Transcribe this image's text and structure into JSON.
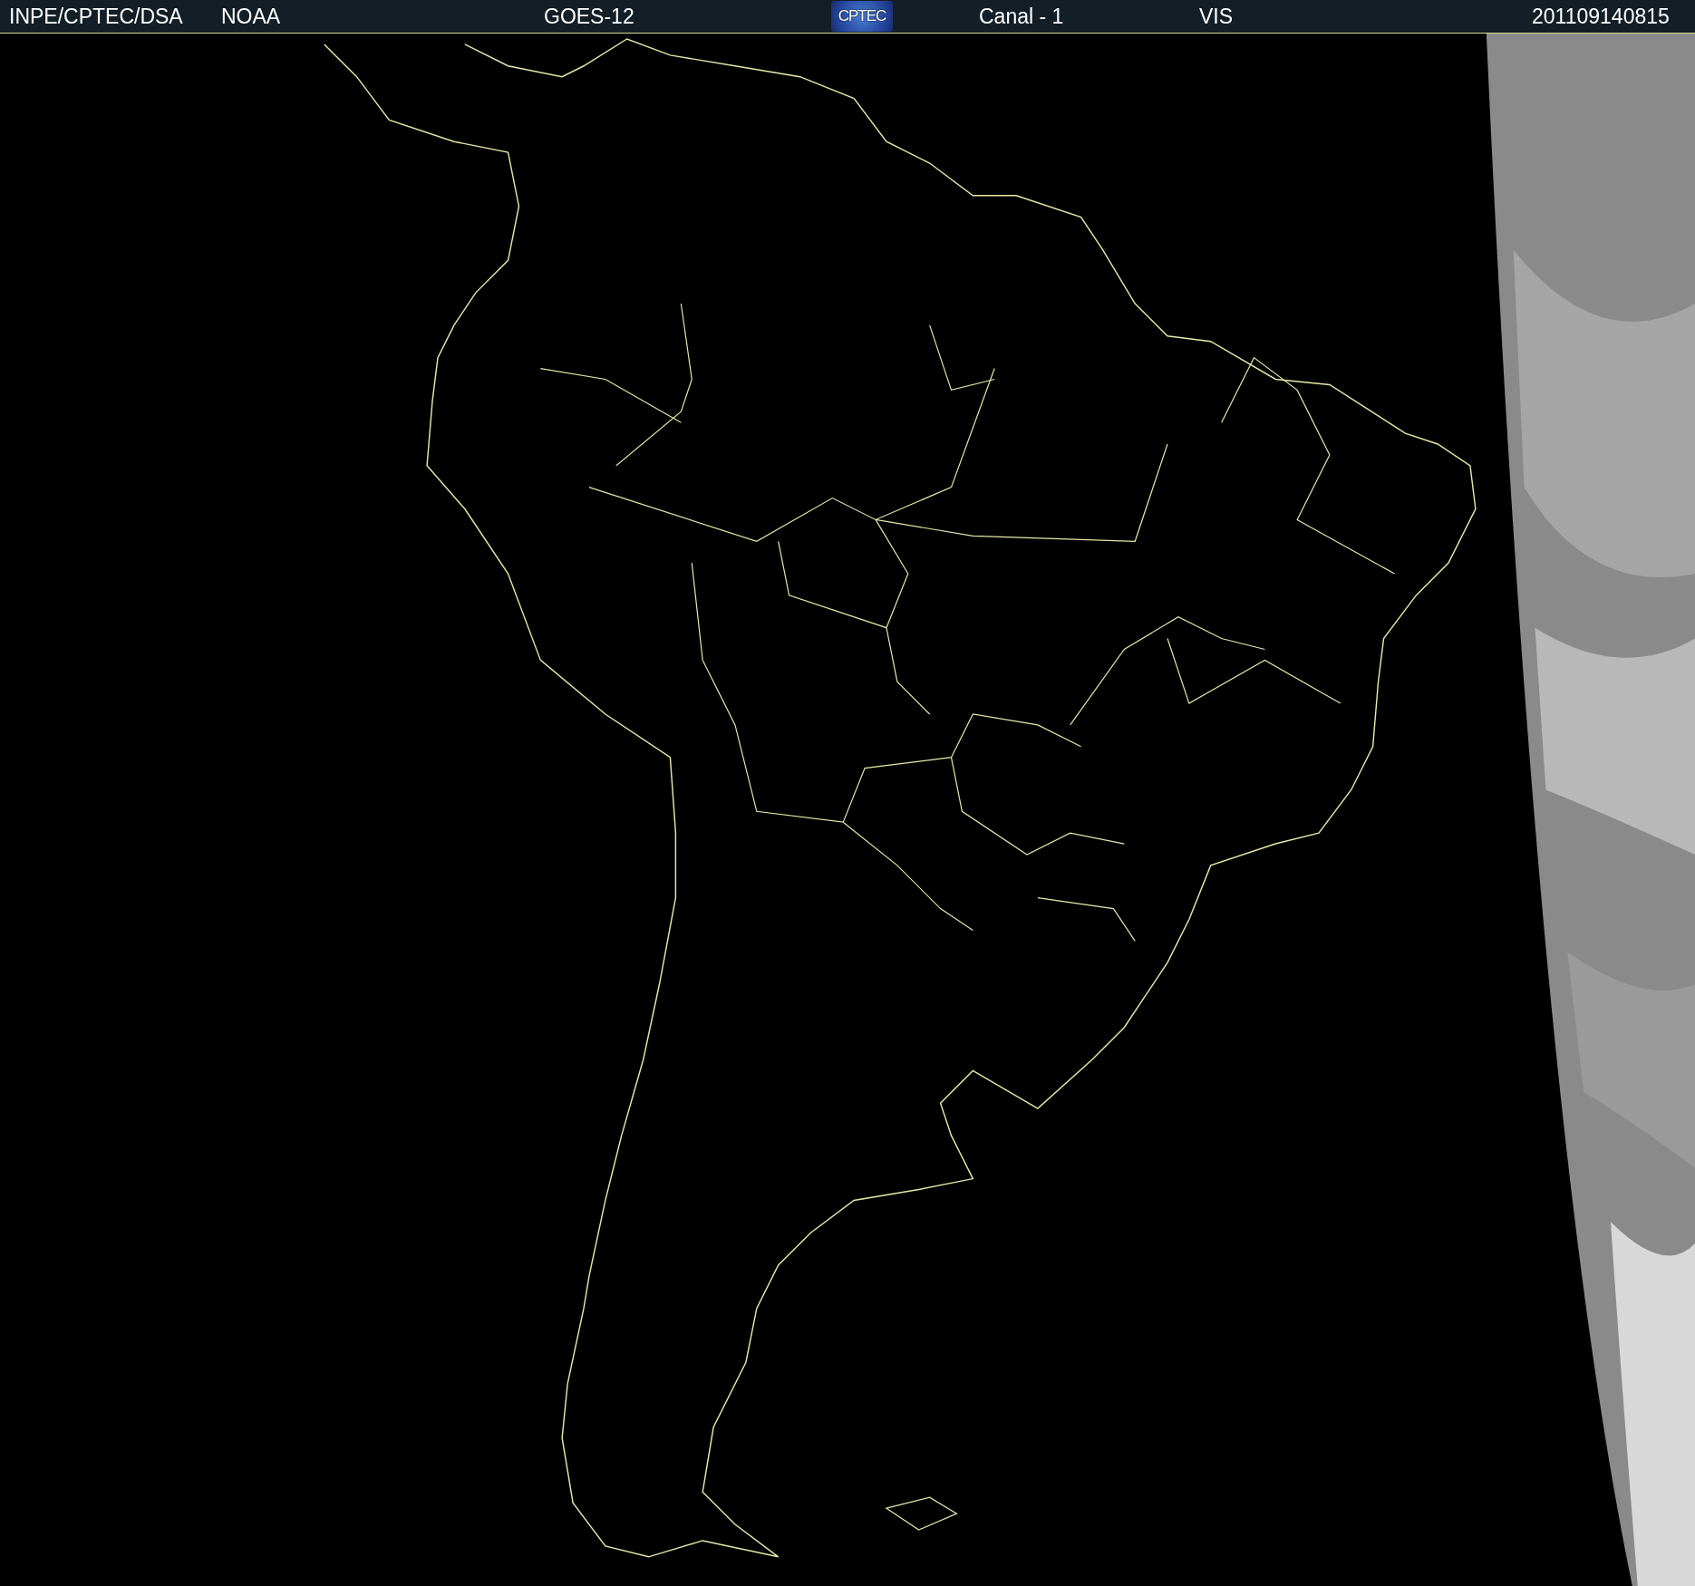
{
  "header": {
    "items": [
      {
        "kind": "text",
        "text": "INPE/CPTEC/DSA"
      },
      {
        "kind": "text",
        "text": "NOAA"
      },
      {
        "kind": "text",
        "text": "GOES-12"
      },
      {
        "kind": "logo",
        "text": "CPTEC"
      },
      {
        "kind": "text",
        "text": "Canal - 1"
      },
      {
        "kind": "text",
        "text": "VIS"
      },
      {
        "kind": "text",
        "text": "201109140815"
      }
    ]
  }
}
